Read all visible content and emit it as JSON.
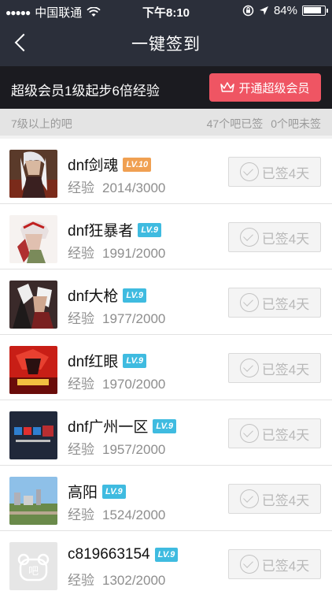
{
  "status_bar": {
    "carrier": "中国联通",
    "time": "下午8:10",
    "battery": "84%"
  },
  "header": {
    "title": "一键签到"
  },
  "vip_bar": {
    "text": "超级会员1级起步6倍经验",
    "button_label": "开通超级会员"
  },
  "sub_bar": {
    "left": "7级以上的吧",
    "signed_count": "47个吧已签",
    "unsigned_count": "0个吧未签"
  },
  "list": {
    "exp_label": "经验",
    "signed_label": "已签4天",
    "items": [
      {
        "name": "dnf剑魂",
        "level": "LV.10",
        "exp": "2014/3000"
      },
      {
        "name": "dnf狂暴者",
        "level": "LV.9",
        "exp": "1991/2000"
      },
      {
        "name": "dnf大枪",
        "level": "LV.9",
        "exp": "1977/2000"
      },
      {
        "name": "dnf红眼",
        "level": "LV.9",
        "exp": "1970/2000"
      },
      {
        "name": "dnf广州一区",
        "level": "LV.9",
        "exp": "1957/2000"
      },
      {
        "name": "高阳",
        "level": "LV.9",
        "exp": "1524/2000"
      },
      {
        "name": "c819663154",
        "level": "LV.9",
        "exp": "1302/2000"
      }
    ]
  },
  "colors": {
    "header_bg": "#2b2f3a",
    "vip_bar_bg": "#1b1b20",
    "vip_button": "#ef5563",
    "level_orange": "#f0a052",
    "level_blue": "#3fbbe0"
  },
  "avatar_placeholder_text": "吧"
}
